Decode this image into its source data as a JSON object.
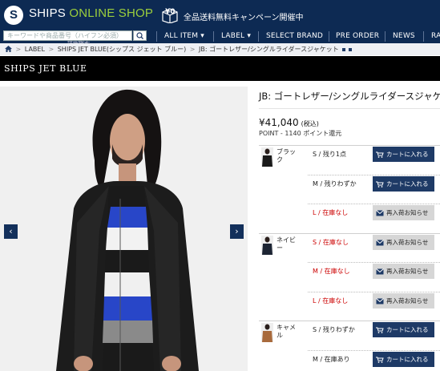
{
  "header": {
    "logo_letter": "S",
    "logo_text_1": "SHIPS ",
    "logo_text_2": "ONLINE SHOP",
    "promo_icon_text": "¥0",
    "promo_text": "全品送料無料キャンペーン開催中",
    "search_placeholder": "キーワードや商品番号（ハイフン必須）",
    "search_advanced": "詳細検索",
    "nav": [
      "ALL ITEM ▾",
      "LABEL ▾",
      "SELECT BRAND",
      "PRE ORDER",
      "NEWS",
      "RA"
    ]
  },
  "breadcrumb": {
    "items": [
      "LABEL",
      "SHIPS JET BLUE(シップス ジェット ブルー)",
      "JB: ゴートレザー/シングルライダースジャケット"
    ],
    "separator": ">"
  },
  "brand": {
    "name": "SHIPS JET BLUE"
  },
  "product": {
    "title": "JB: ゴートレザー/シングルライダースジャケット",
    "price": "¥41,040",
    "tax_note": "(税込)",
    "points": "POINT - 1140 ポイント還元",
    "prev_arrow": "‹",
    "next_arrow": "›",
    "colors": [
      {
        "name": "ブラック",
        "swatch": "#1a1a1a",
        "sizes": [
          {
            "label": "S / 残り1点",
            "status": "instock",
            "button": "カートに入れる"
          },
          {
            "label": "M / 残りわずか",
            "status": "instock",
            "button": "カートに入れる"
          },
          {
            "label": "L / 在庫なし",
            "status": "soldout",
            "button": "再入荷お知らせ"
          }
        ]
      },
      {
        "name": "ネイビー",
        "swatch": "#1c2433",
        "sizes": [
          {
            "label": "S / 在庫なし",
            "status": "soldout",
            "button": "再入荷お知らせ"
          },
          {
            "label": "M / 在庫なし",
            "status": "soldout",
            "button": "再入荷お知らせ"
          },
          {
            "label": "L / 在庫なし",
            "status": "soldout",
            "button": "再入荷お知らせ"
          }
        ]
      },
      {
        "name": "キャメル",
        "swatch": "#a86a3c",
        "sizes": [
          {
            "label": "S / 残りわずか",
            "status": "instock",
            "button": "カートに入れる"
          },
          {
            "label": "M / 在庫あり",
            "status": "instock",
            "button": "カートに入れる"
          }
        ]
      }
    ]
  },
  "colors": {
    "header_bg": "#0d2a53",
    "accent_green": "#9ccf3c",
    "cart_button": "#1e3a66",
    "notify_button": "#d6d6d6",
    "soldout_text": "#cc0000"
  }
}
